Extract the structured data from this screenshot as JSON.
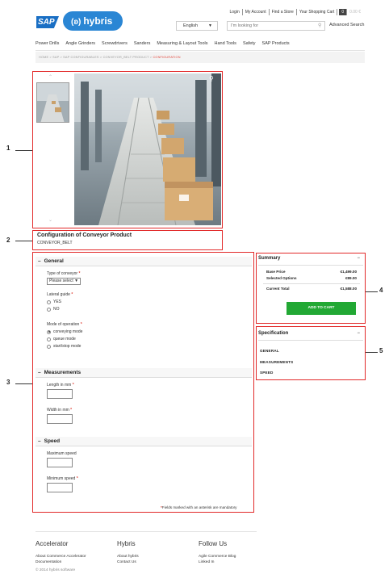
{
  "header": {
    "logo_text": "SAP",
    "hybris_text": "hybris",
    "hybris_mark": "(ʚ)",
    "top_links": [
      "Login",
      "My Account",
      "Find a Store",
      "Your Shopping Cart"
    ],
    "cart_count": "0",
    "cart_extra": "0.00 €",
    "language": "English",
    "search_placeholder": "I'm looking for",
    "advanced_search": "Advanced Search"
  },
  "nav": {
    "items": [
      "Power Drills",
      "Angle Grinders",
      "Screwdrivers",
      "Sanders",
      "Measuring & Layout Tools",
      "Hand Tools",
      "Safety",
      "SAP Products"
    ]
  },
  "breadcrumb": {
    "trail": "HOME  >  SAP  >  SAP CONFIGURABLES  >  CONVEYOR_BELT PRODUCT  >",
    "current": "CONFIGURATION"
  },
  "product": {
    "title": "Configuration of Conveyor Product",
    "code": "CONVEYOR_BELT"
  },
  "config": {
    "general": {
      "title": "General",
      "type_label": "Type of conveyor",
      "type_value": "Please select",
      "lateral_label": "Lateral guide",
      "lateral_options": [
        "YES",
        "NO"
      ],
      "mode_label": "Mode of operation",
      "mode_options": [
        "conveying mode",
        "queue mode",
        "start/stop mode"
      ],
      "mode_selected": "conveying mode"
    },
    "measurements": {
      "title": "Measurements",
      "length_label": "Length in mm",
      "width_label": "Width in mm"
    },
    "speed": {
      "title": "Speed",
      "max_label": "Maximum speed",
      "min_label": "Minimum speed"
    },
    "footnote": "Fields marked with an asterisk are mandatory"
  },
  "summary": {
    "title": "Summary",
    "collapse": "−",
    "base_price_label": "Base Price",
    "base_price": "€1,499.00",
    "options_label": "Selected Options",
    "options_price": "€89.00",
    "total_label": "Current Total",
    "total_price": "€1,588.00",
    "cart_button": "ADD TO CART"
  },
  "specification": {
    "title": "Specification",
    "collapse": "−",
    "items": [
      "GENERAL",
      "MEASUREMENTS",
      "SPEED"
    ]
  },
  "callouts": [
    "1",
    "2",
    "3",
    "4",
    "5"
  ],
  "footer": {
    "col1_title": "Accelerator",
    "col1_links": [
      "About Commerce Accelerator",
      "Documentation"
    ],
    "col2_title": "Hybris",
    "col2_links": [
      "About hybris",
      "Contact Us"
    ],
    "col3_title": "Follow Us",
    "col3_links": [
      "Agile Commerce Blog",
      "Linked In"
    ],
    "copyright": "© 2014 hybris software"
  },
  "colors": {
    "annotation_red": "#e22a2a",
    "cart_green": "#22a834",
    "sap_blue": "#1a6fc4",
    "required_red": "#e0453a"
  },
  "icons": [
    "search-icon",
    "zoom-icon",
    "chevron-up-icon",
    "chevron-down-icon",
    "caret-down-icon"
  ]
}
